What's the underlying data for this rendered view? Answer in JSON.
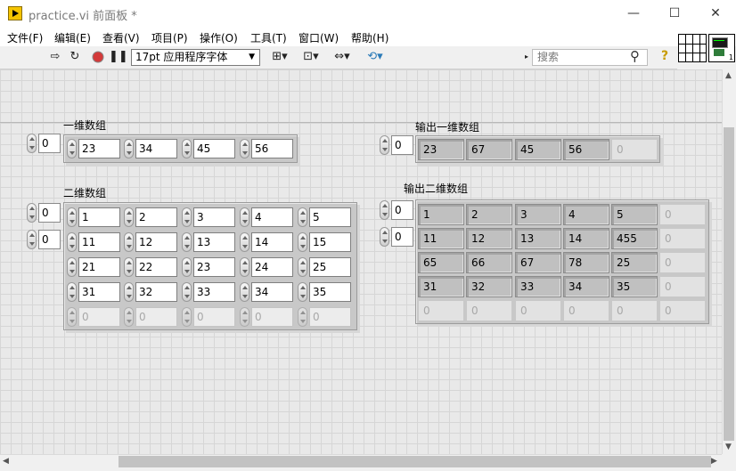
{
  "window": {
    "title": "practice.vi 前面板 *",
    "minimize": "—",
    "maximize": "☐",
    "close": "✕"
  },
  "menu": [
    "文件(F)",
    "编辑(E)",
    "查看(V)",
    "项目(P)",
    "操作(O)",
    "工具(T)",
    "窗口(W)",
    "帮助(H)"
  ],
  "toolbar": {
    "font": "17pt 应用程序字体",
    "search_placeholder": "搜索"
  },
  "icons": {
    "run": "run-arrow-icon",
    "run_continuous": "run-continuously-icon",
    "abort": "abort-icon",
    "pause": "pause-icon",
    "align": "align-objects-icon",
    "distribute": "distribute-objects-icon",
    "resize": "resize-objects-icon",
    "reorder": "reorder-icon",
    "search": "magnifier-icon",
    "help": "context-help-icon"
  },
  "controls": {
    "array1d": {
      "label": "一维数组",
      "index": "0",
      "values": [
        "23",
        "34",
        "45",
        "56"
      ]
    },
    "array2d": {
      "label": "二维数组",
      "row_index": "0",
      "col_index": "0",
      "rows": [
        [
          "1",
          "2",
          "3",
          "4",
          "5"
        ],
        [
          "11",
          "12",
          "13",
          "14",
          "15"
        ],
        [
          "21",
          "22",
          "23",
          "24",
          "25"
        ],
        [
          "31",
          "32",
          "33",
          "34",
          "35"
        ],
        [
          "0",
          "0",
          "0",
          "0",
          "0"
        ]
      ]
    }
  },
  "indicators": {
    "out1d": {
      "label": "输出一维数组",
      "index": "0",
      "values": [
        "23",
        "67",
        "45",
        "56",
        "0"
      ]
    },
    "out2d": {
      "label": "输出二维数组",
      "row_index": "0",
      "col_index": "0",
      "rows": [
        [
          "1",
          "2",
          "3",
          "4",
          "5",
          "0"
        ],
        [
          "11",
          "12",
          "13",
          "14",
          "455",
          "0"
        ],
        [
          "65",
          "66",
          "67",
          "78",
          "25",
          "0"
        ],
        [
          "31",
          "32",
          "33",
          "34",
          "35",
          "0"
        ],
        [
          "0",
          "0",
          "0",
          "0",
          "0",
          "0"
        ]
      ]
    }
  },
  "colors": {
    "canvas": "#e9e9e9",
    "grid": "#d6d6d6",
    "indicator": "#c0c0c0",
    "abort": "#d33a3a",
    "help": "#c79b00"
  }
}
